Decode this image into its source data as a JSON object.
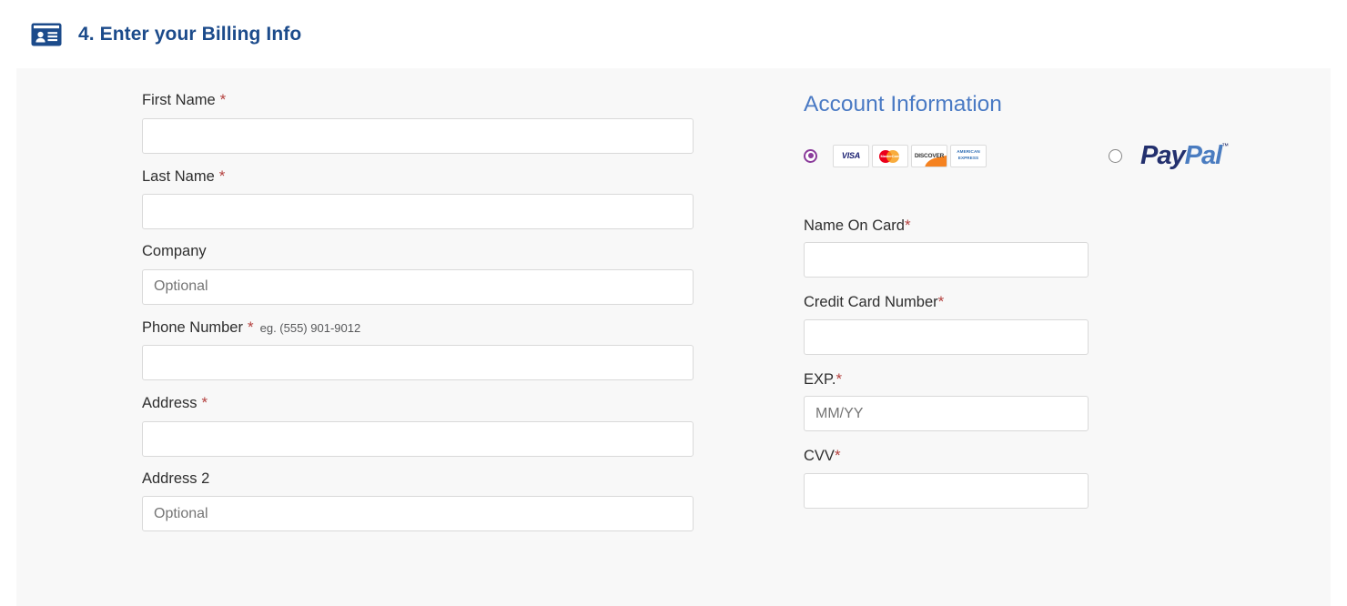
{
  "header": {
    "icon": "id-card-icon",
    "title": "4. Enter your Billing Info",
    "title_color": "#1c4b8b"
  },
  "billing_form": {
    "fields": [
      {
        "label": "First Name",
        "required": true,
        "required_mark": "*",
        "hint": "",
        "placeholder": "",
        "value": ""
      },
      {
        "label": "Last Name",
        "required": true,
        "required_mark": "*",
        "hint": "",
        "placeholder": "",
        "value": ""
      },
      {
        "label": "Company",
        "required": false,
        "required_mark": "",
        "hint": "",
        "placeholder": "Optional",
        "value": ""
      },
      {
        "label": "Phone Number",
        "required": true,
        "required_mark": "*",
        "hint": "eg. (555) 901-9012",
        "placeholder": "",
        "value": ""
      },
      {
        "label": "Address",
        "required": true,
        "required_mark": "*",
        "hint": "",
        "placeholder": "",
        "value": ""
      },
      {
        "label": "Address 2",
        "required": false,
        "required_mark": "",
        "hint": "",
        "placeholder": "Optional",
        "value": ""
      }
    ]
  },
  "account": {
    "heading": "Account Information",
    "heading_color": "#4a7ac4",
    "payment_methods": [
      {
        "id": "credit-card",
        "selected": true,
        "accent_color": "#8b3c9b",
        "cards": [
          {
            "name": "visa",
            "label": "VISA"
          },
          {
            "name": "mastercard",
            "label": "MasterCard"
          },
          {
            "name": "discover",
            "label": "DISCOVER"
          },
          {
            "name": "american-express",
            "label_line1": "AMERICAN",
            "label_line2": "EXPRESS"
          }
        ]
      },
      {
        "id": "paypal",
        "selected": false,
        "logo_part1": "Pay",
        "logo_part2": "Pal",
        "logo_tm": "™"
      }
    ],
    "fields": [
      {
        "label": "Name On Card",
        "required": true,
        "required_mark": "*",
        "placeholder": "",
        "value": ""
      },
      {
        "label": "Credit Card Number",
        "required": true,
        "required_mark": "*",
        "placeholder": "",
        "value": ""
      },
      {
        "label": "EXP.",
        "required": true,
        "required_mark": "*",
        "placeholder": "MM/YY",
        "value": ""
      },
      {
        "label": "CVV",
        "required": true,
        "required_mark": "*",
        "placeholder": "",
        "value": ""
      }
    ]
  }
}
